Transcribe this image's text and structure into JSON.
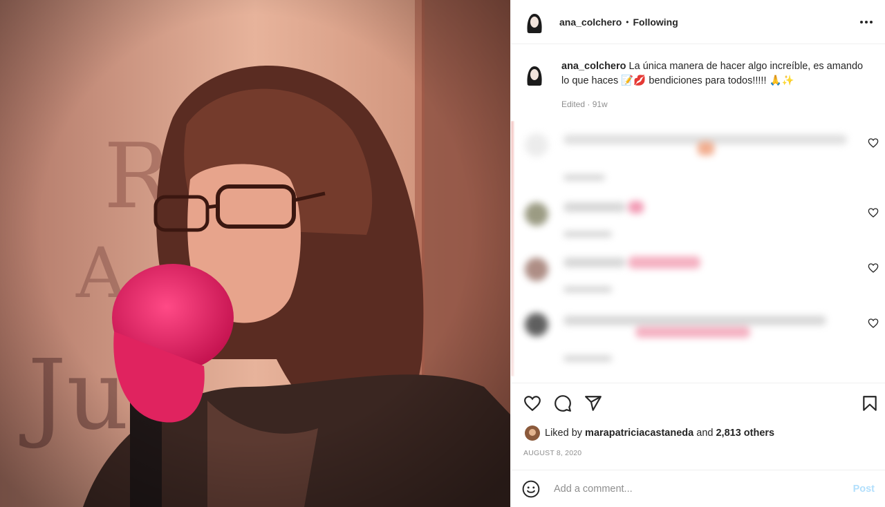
{
  "post": {
    "header": {
      "username": "ana_colchero",
      "separator": "•",
      "follow_status": "Following"
    },
    "caption": {
      "username": "ana_colchero",
      "text": "La única manera de hacer algo increíble, es amando lo que haces 📝💋 bendiciones para todos!!!!! 🙏✨",
      "meta": "Edited · 91w"
    },
    "likes": {
      "liked_by_prefix": "Liked by",
      "liked_by_user": "marapatriciacastaneda",
      "and_text": "and",
      "others": "2,813 others"
    },
    "date": "AUGUST 8, 2020",
    "add_comment": {
      "placeholder": "Add a comment...",
      "post_label": "Post"
    },
    "icons": {
      "more": "more-options-icon",
      "like": "heart-icon",
      "comment": "comment-icon",
      "share": "paper-plane-icon",
      "save": "bookmark-icon",
      "emoji": "emoji-smile-icon"
    },
    "colors": {
      "accent_post": "#b2dffc",
      "muted": "#8e8e8e",
      "text": "#262626"
    }
  }
}
